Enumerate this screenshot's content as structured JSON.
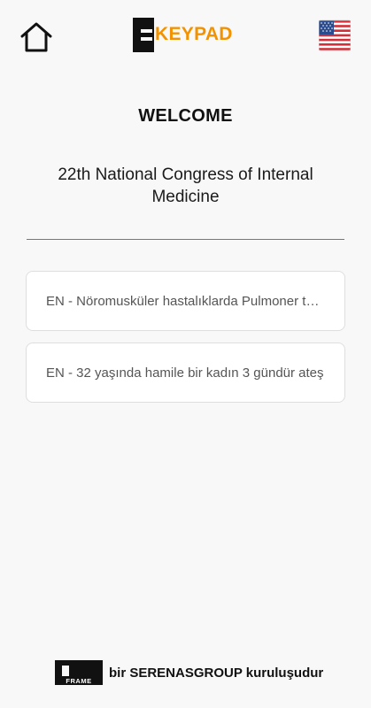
{
  "header": {
    "home_icon": "home-icon",
    "logo_text": "KEYPAD",
    "brand_color": "#f39200",
    "language_flag": "us-flag-icon"
  },
  "main": {
    "welcome": "WELCOME",
    "event_title": "22th National Congress of Internal Medicine",
    "sessions": [
      {
        "label": "EN - Nöromusküler hastalıklarda Pulmoner tutulum"
      },
      {
        "label": "EN - 32 yaşında hamile bir kadın 3 gündür ateş"
      }
    ]
  },
  "footer": {
    "logo_text": "FRAME",
    "text": "bir SERENASGROUP kuruluşudur"
  }
}
